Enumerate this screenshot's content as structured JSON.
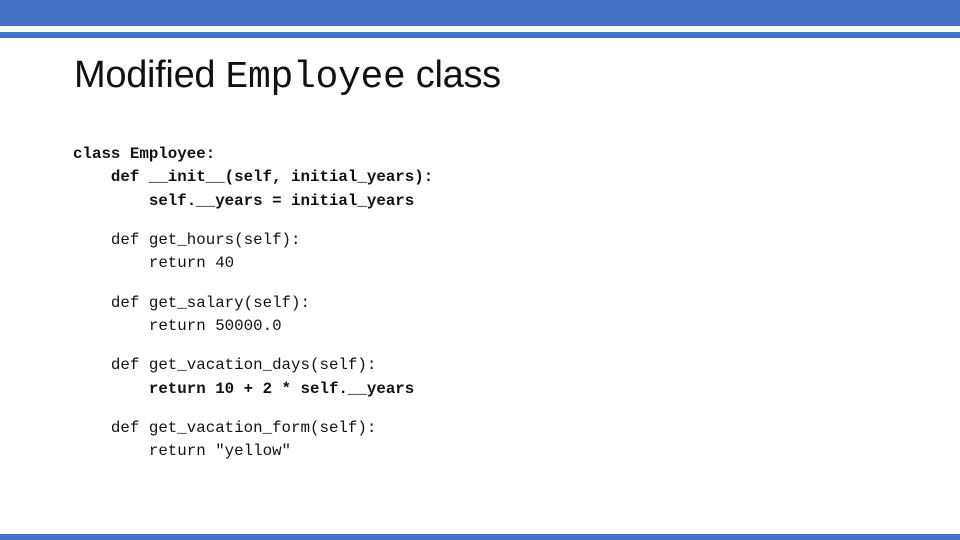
{
  "slide": {
    "title_prefix": "Modified ",
    "title_code": "Employee",
    "title_suffix": " class",
    "accent_color": "#4472c4"
  },
  "code": {
    "blocks": [
      {
        "lines": [
          {
            "text": "class Employee:",
            "bold": true
          },
          {
            "text": "    def __init__(self, initial_years):",
            "bold": true
          },
          {
            "text": "        self.__years = initial_years",
            "bold": true
          }
        ]
      },
      {
        "lines": [
          {
            "text": "    def get_hours(self):",
            "bold": false
          },
          {
            "text": "        return 40",
            "bold": false
          }
        ]
      },
      {
        "lines": [
          {
            "text": "    def get_salary(self):",
            "bold": false
          },
          {
            "text": "        return 50000.0",
            "bold": false
          }
        ]
      },
      {
        "lines": [
          {
            "text": "    def get_vacation_days(self):",
            "bold": false
          },
          {
            "text": "        return 10 + 2 * self.__years",
            "bold": true
          }
        ]
      },
      {
        "lines": [
          {
            "text": "    def get_vacation_form(self):",
            "bold": false
          },
          {
            "text": "        return \"yellow\"",
            "bold": false
          }
        ]
      }
    ]
  }
}
